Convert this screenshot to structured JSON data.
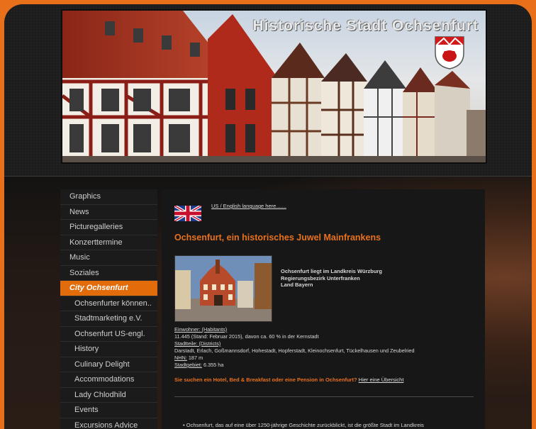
{
  "header": {
    "title": "Historische Stadt Ochsenfurt"
  },
  "sidebar": {
    "items": [
      {
        "label": "Graphics"
      },
      {
        "label": "News"
      },
      {
        "label": "Picturegalleries"
      },
      {
        "label": "Konzerttermine"
      },
      {
        "label": "Music"
      },
      {
        "label": "Soziales"
      },
      {
        "label": "City Ochsenfurt"
      },
      {
        "label": "Ochsenfurter können.."
      },
      {
        "label": "Stadtmarketing e.V."
      },
      {
        "label": "Ochsenfurt US-engl."
      },
      {
        "label": "History"
      },
      {
        "label": "Culinary Delight"
      },
      {
        "label": "Accommodations"
      },
      {
        "label": "Lady Chlodhild"
      },
      {
        "label": "Events"
      },
      {
        "label": "Excursions Advice"
      }
    ],
    "active_index": 6
  },
  "content": {
    "language_link": "US / English language here.......",
    "heading": "Ochsenfurt, ein historisches Juwel Mainfrankens",
    "intro_line1": "Ochsenfurt liegt im Landkreis Würzburg",
    "intro_line2": "Regierungsbezirk Unterfranken",
    "intro_line3": "Land Bayern",
    "residents_label": "Einwohner: (Habitants)",
    "residents_value": "11.445 (Stand: Februar 2015), davon ca. 60 % in der Kernstadt",
    "districts_label": "Stadtteile:  (Districts)",
    "districts_value": "Darstadt, Erlach, Goßmannsdorf, Hohestadt, Hopferstadt, Kleinochsenfurt, Tückelhausen und Zeubelried",
    "nhn_label": "NHN:",
    "nhn_value": " 187 m",
    "area_label": "Stadtgebiet:",
    "area_value": " 6.355 ha",
    "hotel_question": "Sie suchen ein Hotel, Bed & Breakfast oder eine Pension in Ochsenfurt?",
    "hotel_link": "Hier eine Übersicht",
    "bullet_text": "Ochsenfurt, das auf eine über 1250-jährige Geschichte zurückblickt, ist die größte Stadt im Landkreis"
  },
  "colors": {
    "accent": "#e36c0a",
    "background_outer": "#e8701a",
    "panel": "#171717"
  }
}
